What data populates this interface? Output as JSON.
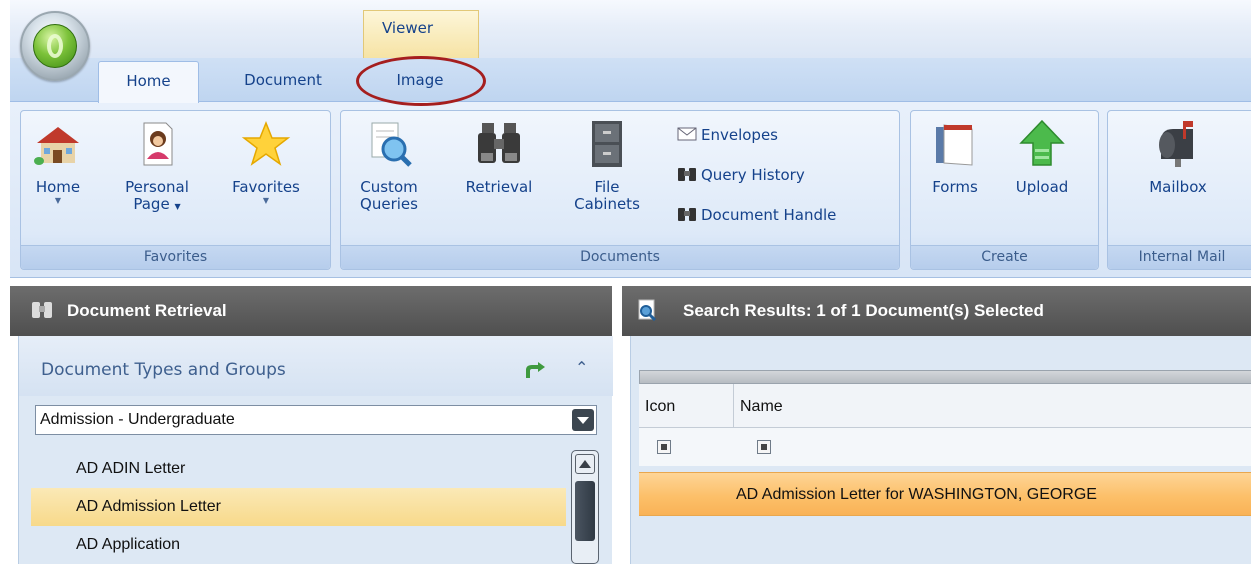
{
  "ribbon": {
    "context_tab_header": "Viewer",
    "tabs": [
      {
        "label": "Home",
        "active": true
      },
      {
        "label": "Document",
        "active": false
      },
      {
        "label": "Image",
        "active": false,
        "highlighted": true
      }
    ],
    "groups": {
      "favorites": {
        "label": "Favorites",
        "buttons": [
          {
            "label": "Home",
            "icon": "house-icon",
            "dropdown": true
          },
          {
            "label_line1": "Personal",
            "label_line2": "Page",
            "icon": "person-page-icon",
            "dropdown": true
          },
          {
            "label": "Favorites",
            "icon": "star-icon",
            "dropdown": true
          }
        ]
      },
      "documents": {
        "label": "Documents",
        "buttons": [
          {
            "label_line1": "Custom",
            "label_line2": "Queries",
            "icon": "magnifier-document-icon"
          },
          {
            "label": "Retrieval",
            "icon": "binoculars-icon"
          },
          {
            "label_line1": "File",
            "label_line2": "Cabinets",
            "icon": "file-cabinet-icon"
          }
        ],
        "small_buttons": [
          {
            "label": "Envelopes",
            "icon": "envelope-icon"
          },
          {
            "label": "Query History",
            "icon": "binoculars-small-icon"
          },
          {
            "label": "Document Handle",
            "icon": "binoculars-small-icon"
          }
        ]
      },
      "create": {
        "label": "Create",
        "buttons": [
          {
            "label": "Forms",
            "icon": "forms-book-icon"
          },
          {
            "label": "Upload",
            "icon": "upload-arrow-icon"
          }
        ]
      },
      "internal_mail": {
        "label": "Internal Mail",
        "buttons": [
          {
            "label": "Mailbox",
            "icon": "mailbox-icon"
          }
        ]
      }
    }
  },
  "left_panel": {
    "title": "Document Retrieval",
    "section_title": "Document Types and Groups",
    "selected_group": "Admission - Undergraduate",
    "document_types": [
      {
        "label": "AD ADIN Letter",
        "selected": false
      },
      {
        "label": "AD Admission Letter",
        "selected": true
      },
      {
        "label": "AD Application",
        "selected": false
      }
    ]
  },
  "right_panel": {
    "title": "Search Results: 1 of 1 Document(s) Selected",
    "columns": [
      "Icon",
      "Name"
    ],
    "rows": [
      {
        "name": "AD Admission Letter for WASHINGTON, GEORGE",
        "selected": true
      }
    ]
  },
  "colors": {
    "ribbon_bg": "#dde9f8",
    "ribbon_text": "#15428b",
    "panel_header": "#5a5a5a",
    "selection_highlight": "#fcc06a",
    "annotation_circle": "#a51e1e",
    "context_tab": "#f6e3a4"
  }
}
